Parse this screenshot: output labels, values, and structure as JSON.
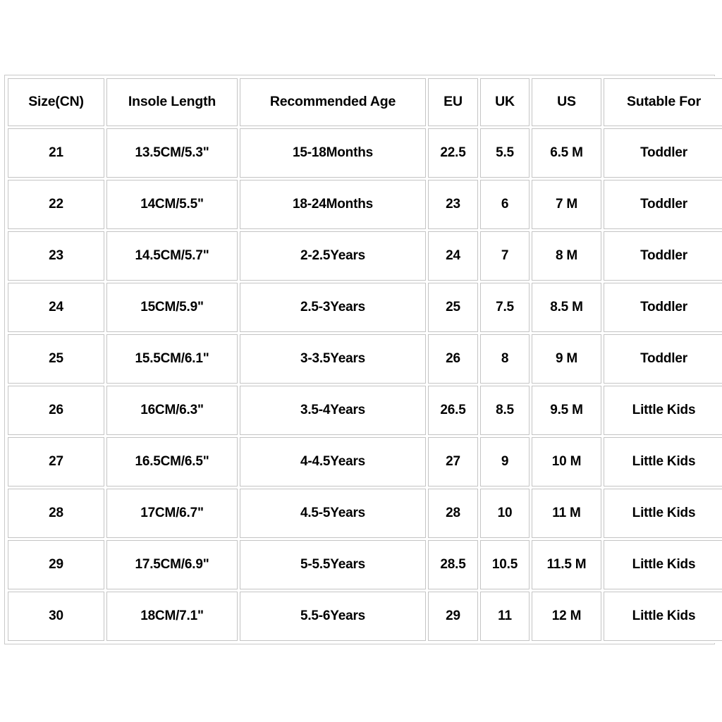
{
  "table": {
    "headers": [
      "Size(CN)",
      "Insole Length",
      "Recommended Age",
      "EU",
      "UK",
      "US",
      "Sutable For"
    ],
    "rows": [
      {
        "size_cn": "21",
        "insole_length": "13.5CM/5.3\"",
        "recommended_age": "15-18Months",
        "eu": "22.5",
        "uk": "5.5",
        "us": "6.5 M",
        "suitable_for": "Toddler"
      },
      {
        "size_cn": "22",
        "insole_length": "14CM/5.5\"",
        "recommended_age": "18-24Months",
        "eu": "23",
        "uk": "6",
        "us": "7 M",
        "suitable_for": "Toddler"
      },
      {
        "size_cn": "23",
        "insole_length": "14.5CM/5.7\"",
        "recommended_age": "2-2.5Years",
        "eu": "24",
        "uk": "7",
        "us": "8 M",
        "suitable_for": "Toddler"
      },
      {
        "size_cn": "24",
        "insole_length": "15CM/5.9\"",
        "recommended_age": "2.5-3Years",
        "eu": "25",
        "uk": "7.5",
        "us": "8.5 M",
        "suitable_for": "Toddler"
      },
      {
        "size_cn": "25",
        "insole_length": "15.5CM/6.1\"",
        "recommended_age": "3-3.5Years",
        "eu": "26",
        "uk": "8",
        "us": "9 M",
        "suitable_for": "Toddler"
      },
      {
        "size_cn": "26",
        "insole_length": "16CM/6.3\"",
        "recommended_age": "3.5-4Years",
        "eu": "26.5",
        "uk": "8.5",
        "us": "9.5 M",
        "suitable_for": "Little Kids"
      },
      {
        "size_cn": "27",
        "insole_length": "16.5CM/6.5\"",
        "recommended_age": "4-4.5Years",
        "eu": "27",
        "uk": "9",
        "us": "10 M",
        "suitable_for": "Little Kids"
      },
      {
        "size_cn": "28",
        "insole_length": "17CM/6.7\"",
        "recommended_age": "4.5-5Years",
        "eu": "28",
        "uk": "10",
        "us": "11 M",
        "suitable_for": "Little Kids"
      },
      {
        "size_cn": "29",
        "insole_length": "17.5CM/6.9\"",
        "recommended_age": "5-5.5Years",
        "eu": "28.5",
        "uk": "10.5",
        "us": "11.5 M",
        "suitable_for": "Little Kids"
      },
      {
        "size_cn": "30",
        "insole_length": "18CM/7.1\"",
        "recommended_age": "5.5-6Years",
        "eu": "29",
        "uk": "11",
        "us": "12 M",
        "suitable_for": "Little Kids"
      }
    ]
  },
  "colors": {
    "background": "#ffffff",
    "cell_background": "#ffffff",
    "border": "#c4c4c4",
    "outer_border": "#c9c9c9",
    "text": "#000000"
  }
}
